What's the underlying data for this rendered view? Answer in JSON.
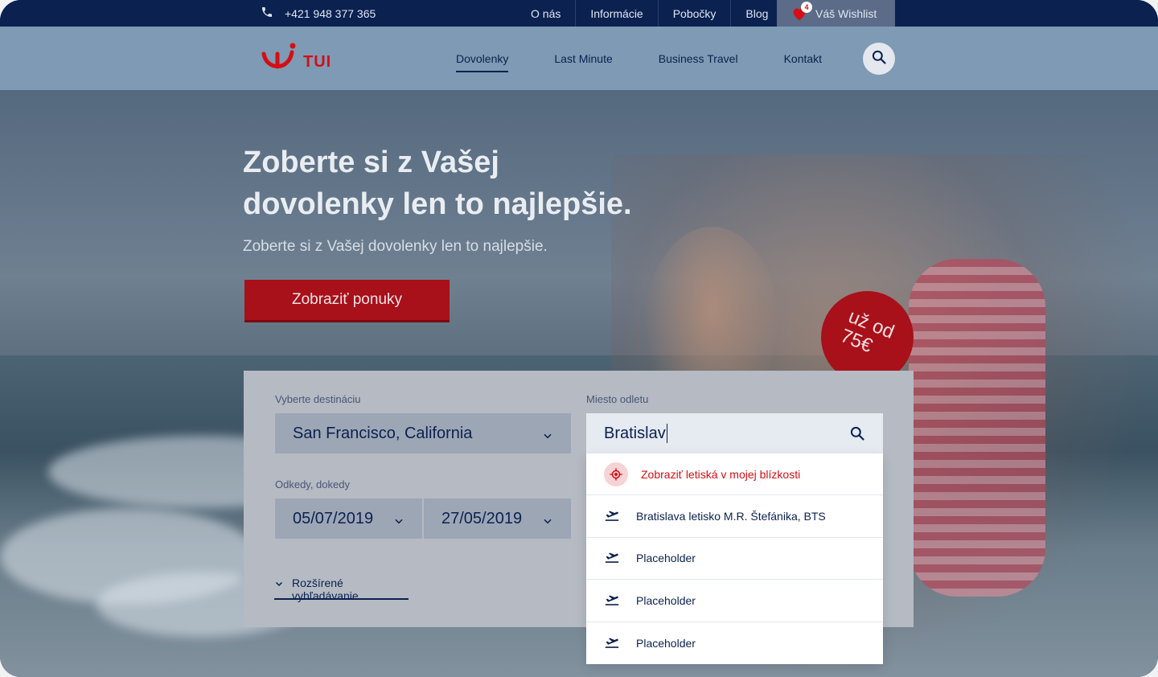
{
  "topbar": {
    "phone": "+421 948 377 365",
    "links": [
      "O nás",
      "Informácie",
      "Pobočky",
      "Blog"
    ],
    "wishlist_label": "Váš Wishlist",
    "wishlist_count": "4"
  },
  "header": {
    "logo_text": "TUI",
    "nav": [
      "Dovolenky",
      "Last Minute",
      "Business Travel",
      "Kontakt"
    ],
    "active_nav": "Dovolenky"
  },
  "hero": {
    "title_line1": "Zoberte si z Vašej",
    "title_line2": "dovolenky len to najlepšie.",
    "subtitle": "Zoberte si z Vašej dovolenky len to najlepšie.",
    "cta_label": "Zobraziť ponuky",
    "badge_line1": "už od",
    "badge_line2": "75€"
  },
  "search": {
    "destination_label": "Vyberte destináciu",
    "destination_value": "San Francisco, California",
    "dates_label": "Odkedy, dokedy",
    "date_from": "05/07/2019",
    "date_to": "27/05/2019",
    "advanced_label": "Rozšírené vyhľadávanie",
    "departure_label": "Miesto odletu",
    "departure_value": "Bratislav",
    "dropdown": {
      "nearby_label": "Zobraziť letiská v mojej blízkosti",
      "items": [
        "Bratislava letisko M.R. Štefánika, BTS",
        "Placeholder",
        "Placeholder",
        "Placeholder"
      ]
    }
  },
  "colors": {
    "brand_red": "#d40e14",
    "navy": "#0b2150"
  }
}
